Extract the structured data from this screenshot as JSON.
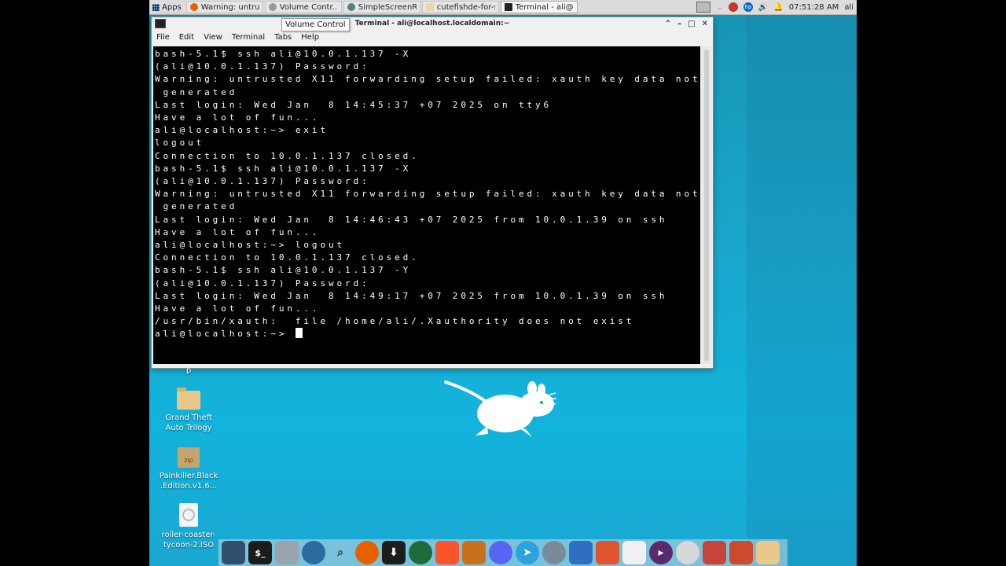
{
  "panel": {
    "apps_label": "Apps",
    "tasks": [
      {
        "label": "Warning: untrust...",
        "icon": "firefox-icon",
        "color": "#e66000"
      },
      {
        "label": "Volume Contr...",
        "icon": "volume-control-icon",
        "color": "#9a9a9a"
      },
      {
        "label": "SimpleScreenRec...",
        "icon": "screen-recorder-icon",
        "color": "#5a7d7d"
      },
      {
        "label": "cutefishde-for-sla...",
        "icon": "file-manager-icon",
        "color": "#e9d8a6"
      },
      {
        "label": "Terminal - ali@loc...",
        "icon": "terminal-icon",
        "color": "#222222"
      }
    ],
    "clock": "07:51:28 AM",
    "user": "ali"
  },
  "tooltip": "Volume Control",
  "terminal": {
    "title": "Terminal - ali@localhost.localdomain:~",
    "menu": [
      "File",
      "Edit",
      "View",
      "Terminal",
      "Tabs",
      "Help"
    ],
    "lines": [
      "bash-5.1$ ssh ali@10.0.1.137 -X",
      "(ali@10.0.1.137) Password:",
      "Warning: untrusted X11 forwarding setup failed: xauth key data not",
      " generated",
      "Last login: Wed Jan  8 14:45:37 +07 2025 on tty6",
      "Have a lot of fun...",
      "ali@localhost:~> exit",
      "logout",
      "Connection to 10.0.1.137 closed.",
      "bash-5.1$ ssh ali@10.0.1.137 -X",
      "(ali@10.0.1.137) Password:",
      "Warning: untrusted X11 forwarding setup failed: xauth key data not",
      " generated",
      "Last login: Wed Jan  8 14:46:43 +07 2025 from 10.0.1.39 on ssh",
      "Have a lot of fun...",
      "ali@localhost:~> logout",
      "Connection to 10.0.1.137 closed.",
      "bash-5.1$ ssh ali@10.0.1.137 -Y",
      "(ali@10.0.1.137) Password:",
      "Last login: Wed Jan  8 14:49:17 +07 2025 from 10.0.1.39 on ssh",
      "Have a lot of fun...",
      "/usr/bin/xauth:  file /home/ali/.Xauthority does not exist"
    ],
    "prompt": "ali@localhost:~> "
  },
  "desktop": {
    "partial_label": "p",
    "icons": [
      {
        "label": "Grand Theft Auto Trilogy",
        "type": "folder"
      },
      {
        "label": "Painkiller.Black .Edition.v1.6...",
        "type": "zip",
        "badge": "zip"
      },
      {
        "label": "roller-coaster- tycoon-2.ISO",
        "type": "disc"
      }
    ]
  },
  "dock": [
    {
      "name": "workspace-icon",
      "color": "#2f4f6f"
    },
    {
      "name": "terminal-icon",
      "color": "#1b1b1b",
      "glyph": "$_"
    },
    {
      "name": "file-manager-icon",
      "color": "#9aa4ad"
    },
    {
      "name": "browser-globe-icon",
      "color": "#2d6aa0"
    },
    {
      "name": "search-magnifier-icon",
      "color": "#5c6670"
    },
    {
      "name": "firefox-icon",
      "color": "#e66000"
    },
    {
      "name": "downloader-icon",
      "color": "#1d1d1d"
    },
    {
      "name": "green-orb-icon",
      "color": "#1f6b3a"
    },
    {
      "name": "brave-lion-icon",
      "color": "#fb542b"
    },
    {
      "name": "game-icon",
      "color": "#c8711d"
    },
    {
      "name": "discord-icon",
      "color": "#5865f2"
    },
    {
      "name": "telegram-icon",
      "color": "#2aa3df"
    },
    {
      "name": "satellite-icon",
      "color": "#7b8a99"
    },
    {
      "name": "document-viewer-icon",
      "color": "#2e6fbf"
    },
    {
      "name": "presentation-icon",
      "color": "#e0532f"
    },
    {
      "name": "sudoku-icon",
      "color": "#f1f1f1"
    },
    {
      "name": "media-player-icon",
      "color": "#5a2a6e"
    },
    {
      "name": "disc-burner-icon",
      "color": "#d8d8d8"
    },
    {
      "name": "gift-box-icon",
      "color": "#c8433a"
    },
    {
      "name": "tools-icon",
      "color": "#cc4b2e"
    },
    {
      "name": "folder-icon",
      "color": "#e7c98b"
    }
  ]
}
